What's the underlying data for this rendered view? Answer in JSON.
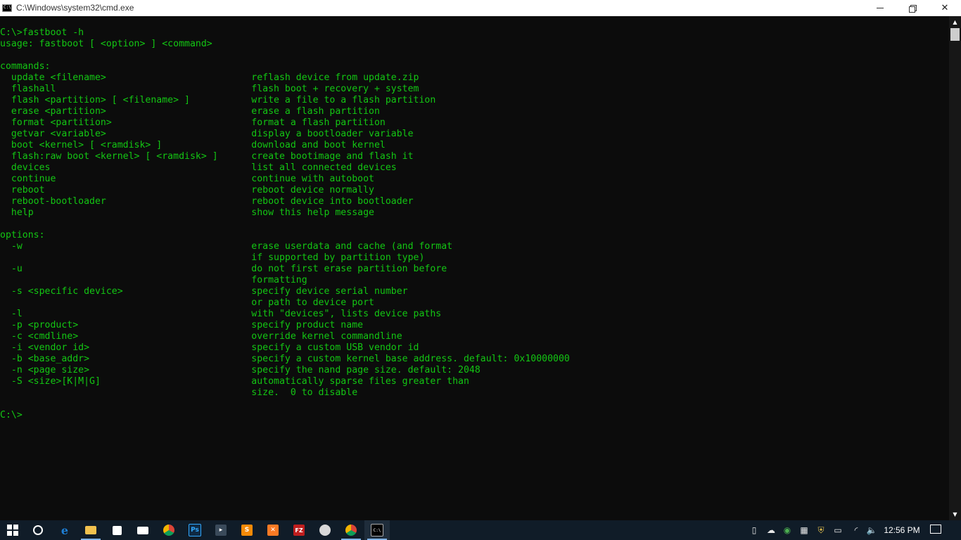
{
  "window": {
    "title": "C:\\Windows\\system32\\cmd.exe",
    "minimize_glyph": "",
    "close_glyph": "✕"
  },
  "console": {
    "text": "C:\\>fastboot -h\nusage: fastboot [ <option> ] <command>\n\ncommands:\n  update <filename>                          reflash device from update.zip\n  flashall                                   flash boot + recovery + system\n  flash <partition> [ <filename> ]           write a file to a flash partition\n  erase <partition>                          erase a flash partition\n  format <partition>                         format a flash partition\n  getvar <variable>                          display a bootloader variable\n  boot <kernel> [ <ramdisk> ]                download and boot kernel\n  flash:raw boot <kernel> [ <ramdisk> ]      create bootimage and flash it\n  devices                                    list all connected devices\n  continue                                   continue with autoboot\n  reboot                                     reboot device normally\n  reboot-bootloader                          reboot device into bootloader\n  help                                       show this help message\n\noptions:\n  -w                                         erase userdata and cache (and format\n                                             if supported by partition type)\n  -u                                         do not first erase partition before\n                                             formatting\n  -s <specific device>                       specify device serial number\n                                             or path to device port\n  -l                                         with \"devices\", lists device paths\n  -p <product>                               specify product name\n  -c <cmdline>                               override kernel commandline\n  -i <vendor id>                             specify a custom USB vendor id\n  -b <base_addr>                             specify a custom kernel base address. default: 0x10000000\n  -n <page size>                             specify the nand page size. default: 2048\n  -S <size>[K|M|G]                           automatically sparse files greater than\n                                             size.  0 to disable\n\nC:\\>",
    "text_color": "#13c613",
    "background": "#0c0c0c"
  },
  "scrollbar": {
    "up_glyph": "▲",
    "down_glyph": "▼"
  },
  "taskbar": {
    "apps": [
      {
        "name": "start-button",
        "icon": "windows-icon",
        "glyph": ""
      },
      {
        "name": "cortana-button",
        "icon": "cortana-icon",
        "glyph": ""
      },
      {
        "name": "edge-button",
        "icon": "edge-icon",
        "glyph": "e",
        "color": "#1e7fd6"
      },
      {
        "name": "file-explorer-button",
        "icon": "folder-icon",
        "glyph": "",
        "color": "#f2c14e"
      },
      {
        "name": "store-button",
        "icon": "store-icon",
        "glyph": "",
        "color": "#ffffff"
      },
      {
        "name": "mail-button",
        "icon": "mail-icon",
        "glyph": "",
        "color": "#ffffff"
      },
      {
        "name": "chrome-button",
        "icon": "chrome-icon",
        "glyph": "",
        "color": "#e0a612"
      },
      {
        "name": "photoshop-button",
        "icon": "photoshop-icon",
        "glyph": "Ps",
        "color": "#0f2a44"
      },
      {
        "name": "app-button",
        "icon": "app-icon",
        "glyph": "▸",
        "color": "#3a4a5a"
      },
      {
        "name": "sublime-button",
        "icon": "sublime-icon",
        "glyph": "S",
        "color": "#f58a07"
      },
      {
        "name": "xampp-button",
        "icon": "xampp-icon",
        "glyph": "✕",
        "color": "#fb7a24"
      },
      {
        "name": "filezilla-button",
        "icon": "filezilla-icon",
        "glyph": "FZ",
        "color": "#bf1e1e"
      },
      {
        "name": "network-app-button",
        "icon": "network-app-icon",
        "glyph": "",
        "color": "#d8d8d8"
      },
      {
        "name": "chrome-2-button",
        "icon": "chrome-icon",
        "glyph": "",
        "color": "#e0a612"
      },
      {
        "name": "cmd-button",
        "icon": "cmd-icon",
        "glyph": "C:\\",
        "color": "#000000"
      }
    ],
    "tray": {
      "usb_glyph": "▯",
      "cloud_glyph": "☁",
      "globe_glyph": "◉",
      "display_glyph": "▦",
      "shield_glyph": "⛨",
      "battery_glyph": "▭",
      "wifi_glyph": "◜",
      "volume_glyph": "🔈"
    },
    "clock": "12:56 PM"
  }
}
